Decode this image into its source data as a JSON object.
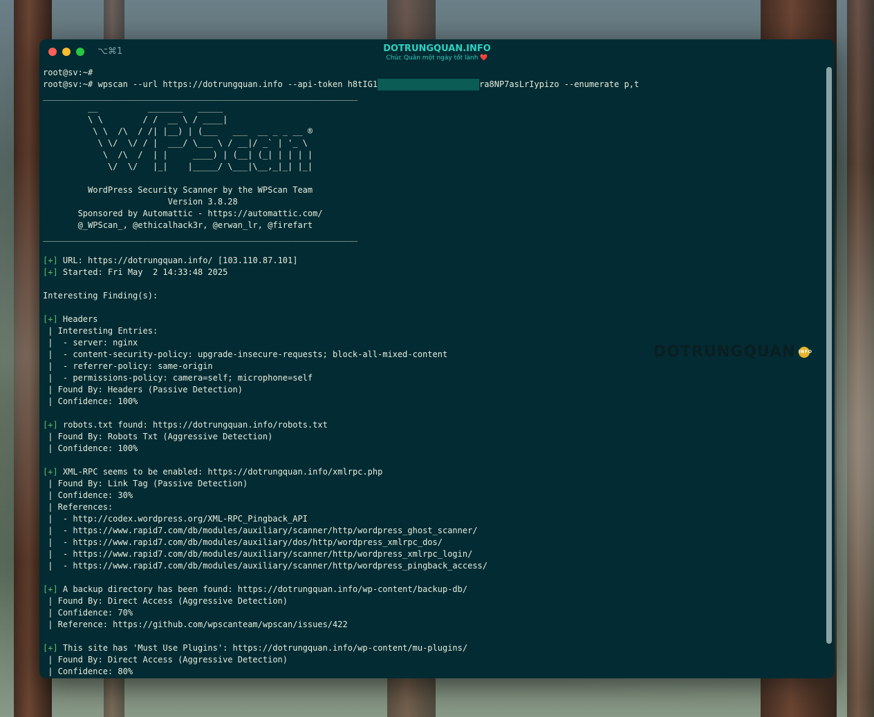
{
  "window": {
    "title": "DOTRUNGQUAN.INFO",
    "subtitle": "Chúc Quân một ngày tốt lành",
    "subtitle_icon": "heart-icon",
    "shortcut": "⌥⌘1"
  },
  "watermark": {
    "text": "DOTRUNGQUAN",
    "badge": "INFO"
  },
  "terminal": {
    "lines": [
      {
        "t": "root@sv:~#"
      },
      {
        "t": "root@sv:~# wpscan --url https://dotrungquan.info --api-token h8tIG1",
        "masked": true,
        "after": "ra8NP7asLrIypizo --enumerate p,t"
      },
      {
        "t": "_______________________________________________________________"
      },
      {
        "t": "         __          _______   _____"
      },
      {
        "t": "         \\ \\        / /  __ \\ / ____|"
      },
      {
        "t": "          \\ \\  /\\  / /| |__) | (___   ___  __ _ _ __ ®"
      },
      {
        "t": "           \\ \\/  \\/ / |  ___/ \\___ \\ / __|/ _` | '_ \\"
      },
      {
        "t": "            \\  /\\  /  | |     ____) | (__| (_| | | | |"
      },
      {
        "t": "             \\/  \\/   |_|    |_____/ \\___|\\__,_|_| |_|"
      },
      {
        "t": ""
      },
      {
        "t": "         WordPress Security Scanner by the WPScan Team"
      },
      {
        "t": "                         Version 3.8.28"
      },
      {
        "t": "       Sponsored by Automattic - https://automattic.com/"
      },
      {
        "t": "       @_WPScan_, @ethicalhack3r, @erwan_lr, @firefart"
      },
      {
        "t": "_______________________________________________________________"
      },
      {
        "t": ""
      },
      {
        "p": "[+]",
        "t": " URL: https://dotrungquan.info/ [103.110.87.101]"
      },
      {
        "p": "[+]",
        "t": " Started: Fri May  2 14:33:48 2025"
      },
      {
        "t": ""
      },
      {
        "t": "Interesting Finding(s):"
      },
      {
        "t": ""
      },
      {
        "p": "[+]",
        "t": " Headers"
      },
      {
        "t": " | Interesting Entries:"
      },
      {
        "t": " |  - server: nginx"
      },
      {
        "t": " |  - content-security-policy: upgrade-insecure-requests; block-all-mixed-content"
      },
      {
        "t": " |  - referrer-policy: same-origin"
      },
      {
        "t": " |  - permissions-policy: camera=self; microphone=self"
      },
      {
        "t": " | Found By: Headers (Passive Detection)"
      },
      {
        "t": " | Confidence: 100%"
      },
      {
        "t": ""
      },
      {
        "p": "[+]",
        "t": " robots.txt found: https://dotrungquan.info/robots.txt"
      },
      {
        "t": " | Found By: Robots Txt (Aggressive Detection)"
      },
      {
        "t": " | Confidence: 100%"
      },
      {
        "t": ""
      },
      {
        "p": "[+]",
        "t": " XML-RPC seems to be enabled: https://dotrungquan.info/xmlrpc.php"
      },
      {
        "t": " | Found By: Link Tag (Passive Detection)"
      },
      {
        "t": " | Confidence: 30%"
      },
      {
        "t": " | References:"
      },
      {
        "t": " |  - http://codex.wordpress.org/XML-RPC_Pingback_API"
      },
      {
        "t": " |  - https://www.rapid7.com/db/modules/auxiliary/scanner/http/wordpress_ghost_scanner/"
      },
      {
        "t": " |  - https://www.rapid7.com/db/modules/auxiliary/dos/http/wordpress_xmlrpc_dos/"
      },
      {
        "t": " |  - https://www.rapid7.com/db/modules/auxiliary/scanner/http/wordpress_xmlrpc_login/"
      },
      {
        "t": " |  - https://www.rapid7.com/db/modules/auxiliary/scanner/http/wordpress_pingback_access/"
      },
      {
        "t": ""
      },
      {
        "p": "[+]",
        "t": " A backup directory has been found: https://dotrungquan.info/wp-content/backup-db/"
      },
      {
        "t": " | Found By: Direct Access (Aggressive Detection)"
      },
      {
        "t": " | Confidence: 70%"
      },
      {
        "t": " | Reference: https://github.com/wpscanteam/wpscan/issues/422"
      },
      {
        "t": ""
      },
      {
        "p": "[+]",
        "t": " This site has 'Must Use Plugins': https://dotrungquan.info/wp-content/mu-plugins/"
      },
      {
        "t": " | Found By: Direct Access (Aggressive Detection)"
      },
      {
        "t": " | Confidence: 80%"
      }
    ]
  },
  "colors": {
    "background": "#022b33",
    "text": "#e8eddc",
    "prefix": "#5bbf6a",
    "title": "#2fd0c0"
  }
}
